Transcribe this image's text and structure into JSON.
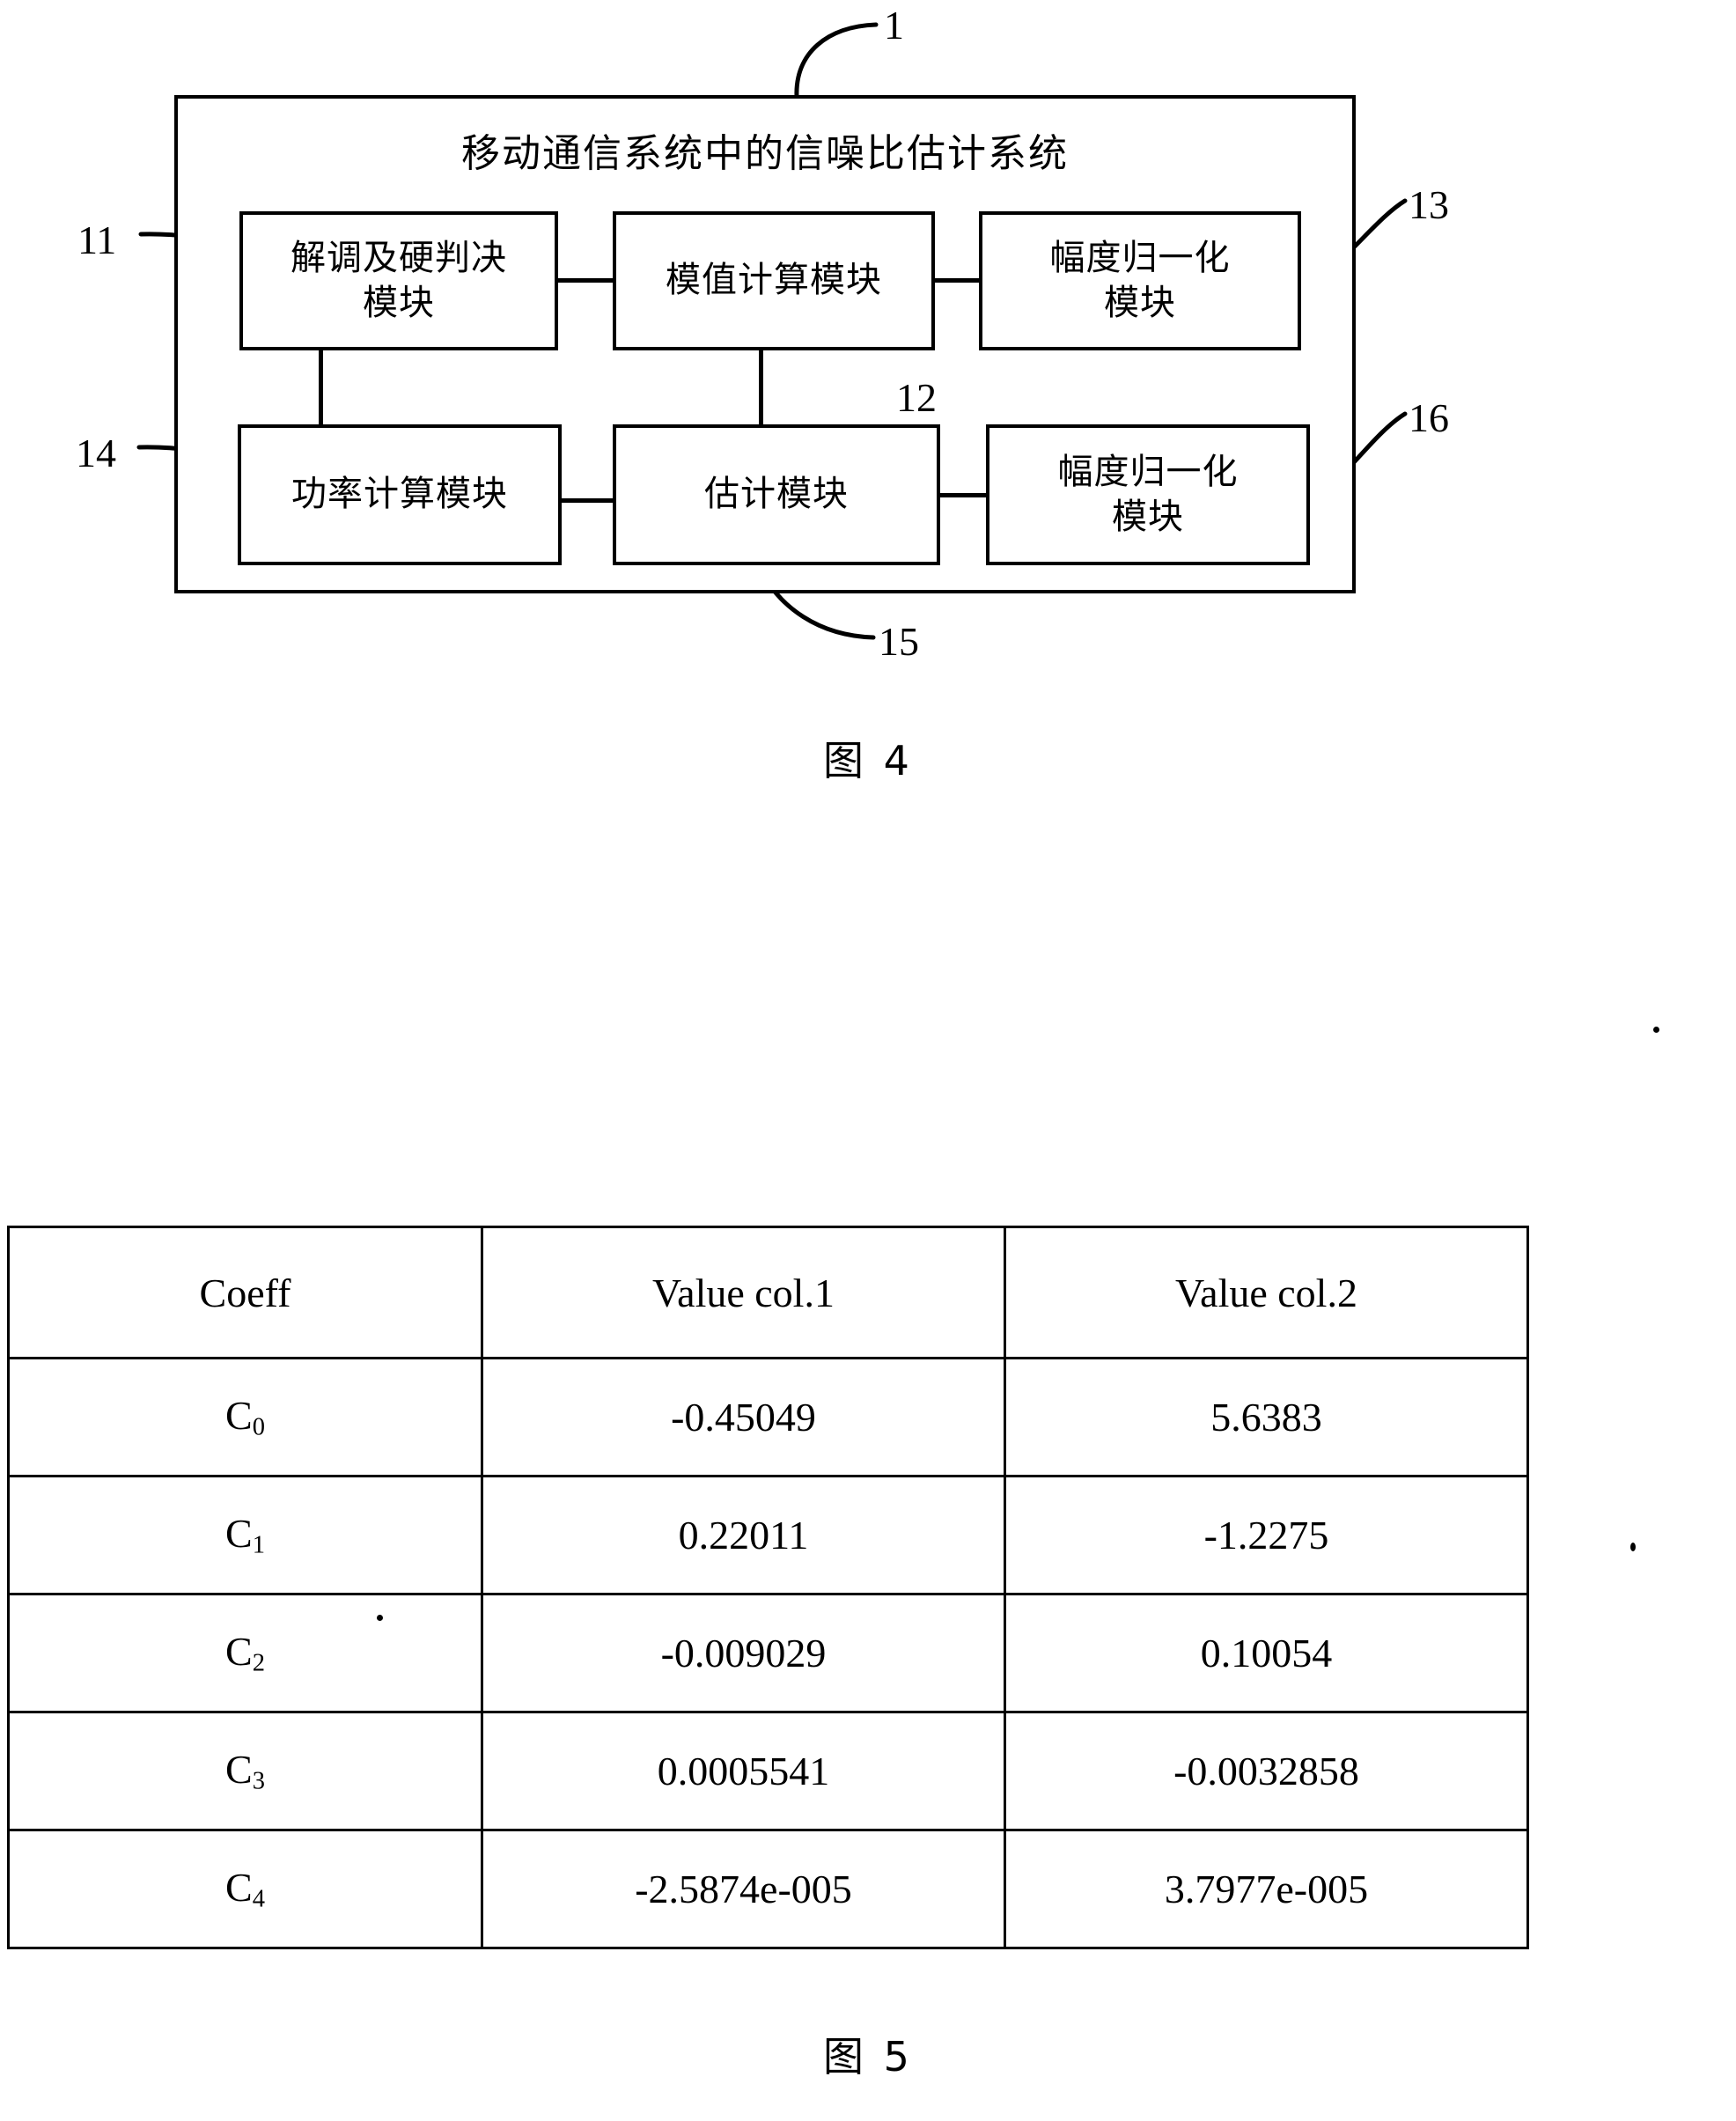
{
  "figure4": {
    "caption": "图 4",
    "system_title": "移动通信系统中的信噪比估计系统",
    "modules": [
      {
        "id": "11",
        "label": "解调及硬判决\n模块",
        "line1": "解调及硬判决",
        "line2": "模块"
      },
      {
        "id": "12",
        "label": "模值计算模块",
        "line1": "模值计算模块",
        "line2": ""
      },
      {
        "id": "13",
        "label": "幅度归一化\n模块",
        "line1": "幅度归一化",
        "line2": "模块"
      },
      {
        "id": "14",
        "label": "功率计算模块",
        "line1": "功率计算模块",
        "line2": ""
      },
      {
        "id": "15",
        "label": "估计模块",
        "line1": "估计模块",
        "line2": ""
      },
      {
        "id": "16",
        "label": "幅度归一化\n模块",
        "line1": "幅度归一化",
        "line2": "模块"
      }
    ],
    "reference_numerals": {
      "system": "1",
      "demod_hard_decision": "11",
      "magnitude_calc": "12",
      "amplitude_norm_top": "13",
      "power_calc": "14",
      "estimation": "15",
      "amplitude_norm_bottom": "16"
    }
  },
  "figure5": {
    "caption": "图 5",
    "table": {
      "headers": [
        "Coeff",
        "Value col.1",
        "Value col.2"
      ],
      "rows": [
        {
          "coeff": "C",
          "sub": "0",
          "col1": "-0.45049",
          "col2": "5.6383"
        },
        {
          "coeff": "C",
          "sub": "1",
          "col1": "0.22011",
          "col2": "-1.2275"
        },
        {
          "coeff": "C",
          "sub": "2",
          "col1": "-0.009029",
          "col2": "0.10054"
        },
        {
          "coeff": "C",
          "sub": "3",
          "col1": "0.0005541",
          "col2": "-0.0032858"
        },
        {
          "coeff": "C",
          "sub": "4",
          "col1": "-2.5874e-005",
          "col2": "3.7977e-005"
        }
      ]
    }
  },
  "colors": {
    "ink": "#000000",
    "paper": "#ffffff"
  }
}
